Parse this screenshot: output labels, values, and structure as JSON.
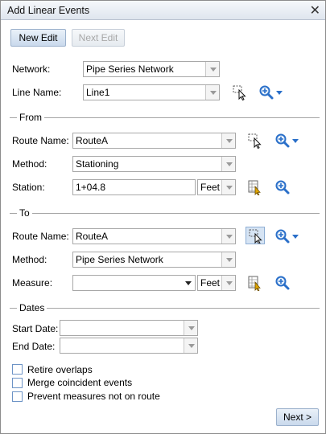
{
  "window": {
    "title": "Add Linear Events"
  },
  "toolbar": {
    "new_edit": "New Edit",
    "next_edit": "Next Edit"
  },
  "network": {
    "label": "Network:",
    "value": "Pipe Series Network"
  },
  "line_name": {
    "label": "Line Name:",
    "value": "Line1"
  },
  "from": {
    "section": "From",
    "route_label": "Route Name:",
    "route_value": "RouteA",
    "method_label": "Method:",
    "method_value": "Stationing",
    "station_label": "Station:",
    "station_value": "1+04.8",
    "units": "Feet"
  },
  "to": {
    "section": "To",
    "route_label": "Route Name:",
    "route_value": "RouteA",
    "method_label": "Method:",
    "method_value": "Pipe Series Network",
    "measure_label": "Measure:",
    "measure_value": "",
    "units": "Feet"
  },
  "dates": {
    "section": "Dates",
    "start_label": "Start Date:",
    "start_value": "",
    "end_label": "End Date:",
    "end_value": ""
  },
  "options": [
    {
      "label": "Retire overlaps",
      "checked": false
    },
    {
      "label": "Merge coincident events",
      "checked": false
    },
    {
      "label": "Prevent measures not on route",
      "checked": false
    }
  ],
  "footer": {
    "next": "Next >"
  },
  "colors": {
    "accent": "#2a6fc9",
    "button_bg": "#c9d9ec",
    "border": "#a8a8a8"
  },
  "icons": [
    "close-icon",
    "select-on-map-icon",
    "zoom-to-icon",
    "table-lookup-icon"
  ]
}
